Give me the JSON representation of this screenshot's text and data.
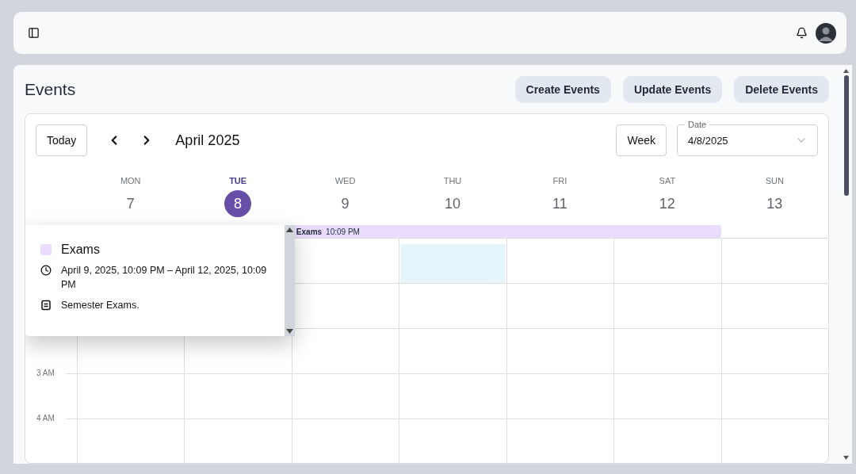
{
  "page": {
    "title": "Events",
    "actions": [
      "Create Events",
      "Update Events",
      "Delete Events"
    ]
  },
  "calendar": {
    "today_button": "Today",
    "period": "April 2025",
    "view_button": "Week",
    "date_field": {
      "label": "Date",
      "value": "4/8/2025"
    },
    "days": [
      {
        "name": "MON",
        "number": "7",
        "selected": false,
        "in_event": false
      },
      {
        "name": "TUE",
        "number": "8",
        "selected": true,
        "in_event": false
      },
      {
        "name": "WED",
        "number": "9",
        "selected": false,
        "in_event": true
      },
      {
        "name": "THU",
        "number": "10",
        "selected": false,
        "in_event": true
      },
      {
        "name": "FRI",
        "number": "11",
        "selected": false,
        "in_event": true
      },
      {
        "name": "SAT",
        "number": "12",
        "selected": false,
        "in_event": true
      },
      {
        "name": "SUN",
        "number": "13",
        "selected": false,
        "in_event": false
      }
    ],
    "event": {
      "title": "Exams",
      "time": "10:09 PM",
      "color": "#e9dcfd"
    },
    "time_rows": [
      {
        "cells": [
          {},
          {},
          {
            "selected": false
          },
          {
            "selected": true
          },
          {
            "selected": false
          },
          {
            "selected": false
          },
          {
            "selected": false
          }
        ]
      },
      {
        "cells": [
          {},
          {},
          {
            "selected": false
          },
          {
            "selected": false
          },
          {
            "selected": false
          },
          {
            "selected": false
          },
          {
            "selected": false
          }
        ]
      },
      {
        "cells": [
          {
            "selected": false
          },
          {
            "selected": false
          },
          {
            "selected": false
          },
          {
            "selected": false
          },
          {
            "selected": false
          },
          {
            "selected": false
          },
          {
            "selected": false
          }
        ]
      },
      {
        "label": "3 AM",
        "cells": [
          {
            "selected": false
          },
          {
            "selected": false
          },
          {
            "selected": false
          },
          {
            "selected": false
          },
          {
            "selected": false
          },
          {
            "selected": false
          },
          {
            "selected": false
          }
        ]
      },
      {
        "label": "4 AM",
        "cells": [
          {
            "selected": false
          },
          {
            "selected": false
          },
          {
            "selected": false
          },
          {
            "selected": false
          },
          {
            "selected": false
          },
          {
            "selected": false
          },
          {
            "selected": false
          }
        ]
      }
    ],
    "popover": {
      "title": "Exams",
      "color": "#e9dcfd",
      "when": "April 9, 2025, 10:09 PM – April 12, 2025, 10:09 PM",
      "note": "Semester Exams."
    }
  }
}
